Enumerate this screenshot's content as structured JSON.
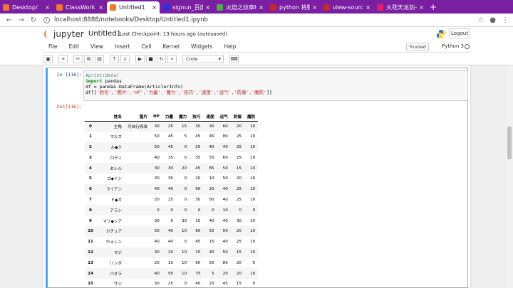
{
  "browser": {
    "tabs": [
      {
        "label": "Desktop/",
        "color": "#f37726"
      },
      {
        "label": "ClassWork",
        "color": "#f37726"
      },
      {
        "label": "Untitled1",
        "color": "#f37726",
        "active": true
      },
      {
        "label": "signun_百度搜",
        "color": "#2932e1"
      },
      {
        "label": "火焰之纹章H",
        "color": "#4caf50"
      },
      {
        "label": "python 将数",
        "color": "#c62828"
      },
      {
        "label": "view-source:",
        "color": "#c62828"
      },
      {
        "label": "火花天龙剑—",
        "color": "#e91e63"
      }
    ],
    "url": "localhost:8888/notebooks/Desktop/Untitled1.ipynb"
  },
  "jupyter": {
    "logo_text": "jupyter",
    "notebook_title": "Untitled1",
    "checkpoint": "Last Checkpoint: 13 hours ago (autosaved)",
    "logout_label": "Logout",
    "menu": [
      "File",
      "Edit",
      "View",
      "Insert",
      "Cell",
      "Kernel",
      "Widgets",
      "Help"
    ],
    "trusted_label": "Trusted",
    "kernel_name": "Python 3",
    "celltype": "Code"
  },
  "cell": {
    "in_prompt": "In  [116]:",
    "out_prompt": "Out[116]:",
    "code_line1": "#print(data)",
    "code_line2_kw": "import",
    "code_line2_rest": " pandas",
    "code_line3": "df = pandas.DataFrame(ArticlerInfo)",
    "code_line4_pre": "df[[",
    "code_line4_str": "'姓名','图片','HP','力量','魔力','技巧','速度','运气','防御','魔防'",
    "code_line4_post": "]]"
  },
  "table": {
    "columns": [
      "姓名",
      "图片",
      "HP",
      "力量",
      "魔力",
      "技巧",
      "速度",
      "运气",
      "防御",
      "魔防"
    ],
    "rows": [
      [
        "0",
        "主角",
        "可自行修改",
        "30",
        "25",
        "15",
        "30",
        "30",
        "60",
        "20",
        "10"
      ],
      [
        "1",
        "マルス",
        "",
        "50",
        "45",
        "5",
        "45",
        "45",
        "80",
        "25",
        "10"
      ],
      [
        "2",
        "ル◆ク",
        "",
        "50",
        "45",
        "0",
        "25",
        "40",
        "40",
        "25",
        "10"
      ],
      [
        "3",
        "ロディ",
        "",
        "40",
        "35",
        "0",
        "35",
        "55",
        "60",
        "25",
        "10"
      ],
      [
        "4",
        "セシル",
        "",
        "30",
        "30",
        "20",
        "45",
        "65",
        "50",
        "15",
        "10"
      ],
      [
        "5",
        "ゴ◆ドン",
        "",
        "30",
        "30",
        "0",
        "20",
        "10",
        "50",
        "20",
        "10"
      ],
      [
        "6",
        "ライアン",
        "",
        "40",
        "40",
        "0",
        "60",
        "20",
        "40",
        "25",
        "10"
      ],
      [
        "7",
        "ド◆ガ",
        "",
        "20",
        "25",
        "0",
        "30",
        "50",
        "40",
        "25",
        "10"
      ],
      [
        "8",
        "アラン",
        "",
        "0",
        "0",
        "0",
        "0",
        "0",
        "10",
        "0",
        "0"
      ],
      [
        "9",
        "マリ◆シア",
        "",
        "30",
        "0",
        "30",
        "15",
        "40",
        "40",
        "30",
        "10"
      ],
      [
        "10",
        "カチュア",
        "",
        "50",
        "40",
        "10",
        "60",
        "55",
        "50",
        "20",
        "10"
      ],
      [
        "11",
        "ウォレン",
        "",
        "40",
        "40",
        "0",
        "45",
        "15",
        "40",
        "25",
        "10"
      ],
      [
        "12",
        "マジ",
        "",
        "30",
        "20",
        "10",
        "15",
        "40",
        "50",
        "15",
        "10"
      ],
      [
        "13",
        "リンダ",
        "",
        "20",
        "10",
        "10",
        "60",
        "55",
        "80",
        "20",
        "5"
      ],
      [
        "14",
        "パオラ",
        "",
        "40",
        "50",
        "10",
        "75",
        "5",
        "20",
        "20",
        "10"
      ],
      [
        "15",
        "サジ",
        "",
        "30",
        "25",
        "0",
        "40",
        "20",
        "45",
        "15",
        "0"
      ]
    ]
  }
}
